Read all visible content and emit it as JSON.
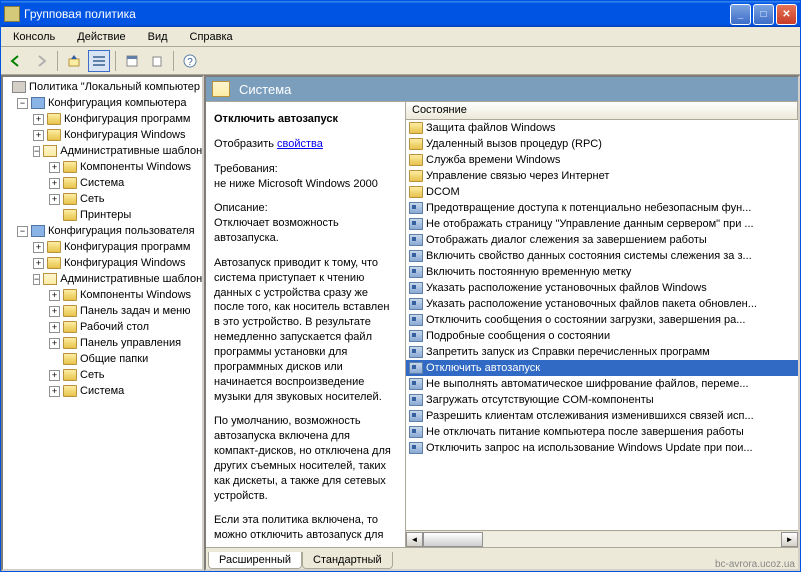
{
  "title": "Групповая политика",
  "menu": {
    "console": "Консоль",
    "action": "Действие",
    "view": "Вид",
    "help": "Справка"
  },
  "tree": {
    "root": "Политика \"Локальный компьютер",
    "cfg_computer": "Конфигурация компьютера",
    "cfg_prog": "Конфигурация программ",
    "cfg_win": "Конфигурация Windows",
    "adm_templ": "Административные шаблоны",
    "comp_win": "Компоненты Windows",
    "system": "Система",
    "network": "Сеть",
    "printers": "Принтеры",
    "cfg_user": "Конфигурация пользователя",
    "taskbar": "Панель задач и меню",
    "desktop": "Рабочий стол",
    "cpanel": "Панель управления",
    "shared": "Общие папки"
  },
  "header": {
    "title": "Система"
  },
  "col": {
    "state": "Состояние"
  },
  "desc": {
    "title": "Отключить автозапуск",
    "proplabel": "Отобразить ",
    "proplink": "свойства",
    "reqlabel": "Требования:",
    "req": "не ниже Microsoft Windows 2000",
    "desclabel": "Описание:",
    "p1": "Отключает возможность автозапуска.",
    "p2": "Автозапуск приводит к тому, что система приступает к чтению данных с устройства сразу же после того, как носитель вставлен в это устройство. В результате немедленно запускается файл программы установки для программных дисков или начинается воспроизведение музыки для звуковых носителей.",
    "p3": "По умолчанию, возможность автозапуска включена для компакт-дисков, но отключена для других съемных носителей, таких как дискеты, а также для сетевых устройств.",
    "p4": "Если эта политика включена, то можно отключить автозапуск для"
  },
  "list": {
    "items": [
      {
        "icon": "folder",
        "label": "Защита файлов Windows"
      },
      {
        "icon": "folder",
        "label": "Удаленный вызов процедур (RPC)"
      },
      {
        "icon": "folder",
        "label": "Служба времени Windows"
      },
      {
        "icon": "folder",
        "label": "Управление связью через Интернет"
      },
      {
        "icon": "folder",
        "label": "DCOM"
      },
      {
        "icon": "policy",
        "label": "Предотвращение доступа к потенциально небезопасным фун..."
      },
      {
        "icon": "policy",
        "label": "Не отображать страницу \"Управление данным сервером\" при ..."
      },
      {
        "icon": "policy",
        "label": "Отображать диалог слежения за завершением работы"
      },
      {
        "icon": "policy",
        "label": "Включить свойство данных состояния системы слежения за з..."
      },
      {
        "icon": "policy",
        "label": "Включить постоянную временную метку"
      },
      {
        "icon": "policy",
        "label": "Указать расположение установочных файлов Windows"
      },
      {
        "icon": "policy",
        "label": "Указать расположение установочных файлов пакета обновлен..."
      },
      {
        "icon": "policy",
        "label": "Отключить сообщения о состоянии загрузки, завершения ра..."
      },
      {
        "icon": "policy",
        "label": "Подробные сообщения о состоянии"
      },
      {
        "icon": "policy",
        "label": "Запретить запуск из Справки перечисленных программ"
      },
      {
        "icon": "policy",
        "label": "Отключить автозапуск",
        "selected": true
      },
      {
        "icon": "policy",
        "label": "Не выполнять автоматическое шифрование файлов, переме..."
      },
      {
        "icon": "policy",
        "label": "Загружать отсутствующие COM-компоненты"
      },
      {
        "icon": "policy",
        "label": "Разрешить клиентам отслеживания изменившихся связей исп..."
      },
      {
        "icon": "policy",
        "label": "Не отключать питание компьютера после завершения работы"
      },
      {
        "icon": "policy",
        "label": "Отключить запрос на использование Windows Update при пои..."
      }
    ]
  },
  "tabs": {
    "ext": "Расширенный",
    "std": "Стандартный"
  },
  "watermark": "bc-avrora.ucoz.ua"
}
